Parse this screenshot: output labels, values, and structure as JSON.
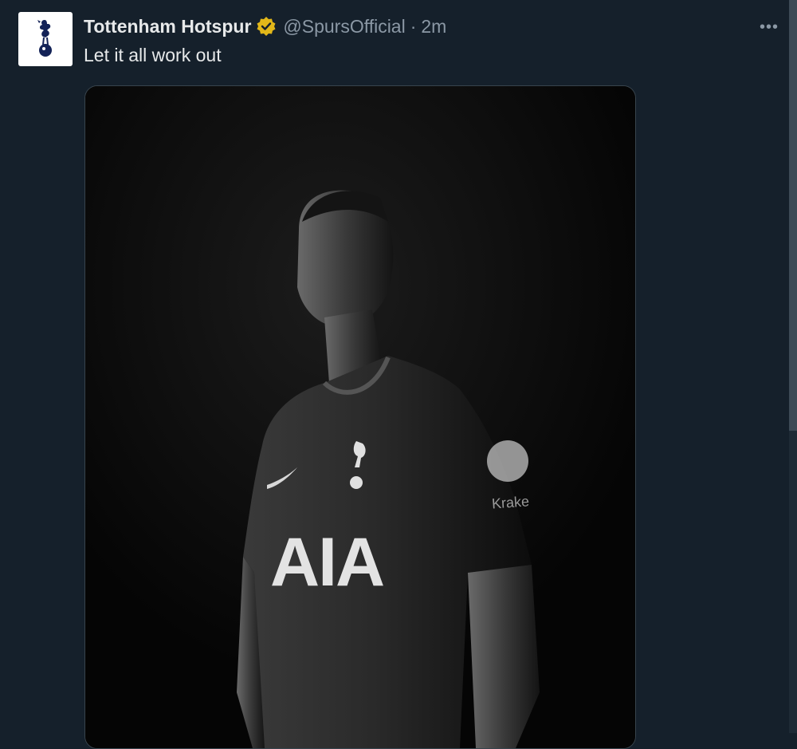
{
  "tweet": {
    "display_name": "Tottenham Hotspur",
    "handle": "@SpursOfficial",
    "separator": "·",
    "time": "2m",
    "text": "Let it all work out",
    "more_label": "•••"
  },
  "avatar": {
    "icon": "spurs-cockerel-crest-icon"
  },
  "verified": {
    "icon": "verified-badge-icon",
    "color": "#e2b719"
  },
  "media": {
    "kit_sponsor": "AIA",
    "sleeve_sponsor": "Kraken",
    "kit_brand_icon": "swoosh-icon"
  },
  "colors": {
    "background": "#15202b",
    "text": "#e7e9ea",
    "muted": "#8b98a5",
    "border": "#38444d"
  }
}
